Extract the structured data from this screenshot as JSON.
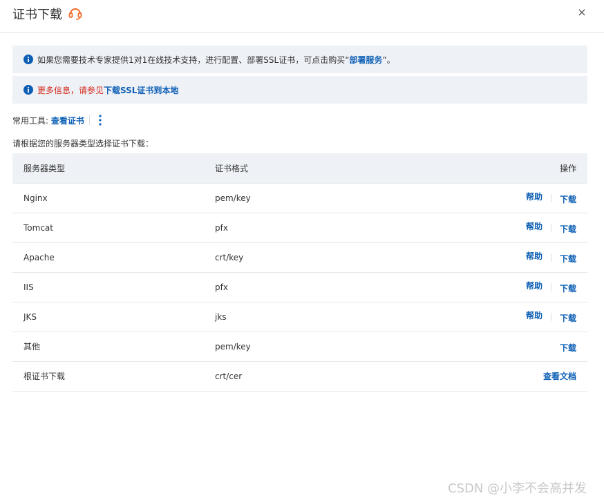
{
  "dialog": {
    "title": "证书下载",
    "close_symbol": "×"
  },
  "notice1": {
    "text_prefix": "如果您需要技术专家提供1对1在线技术支持，进行配置、部署SSL证书，可点击购买“",
    "link": "部署服务",
    "text_suffix": "”。"
  },
  "notice2": {
    "text_prefix": "更多信息，请参见",
    "link": "下载SSL证书到本地"
  },
  "tools": {
    "label": "常用工具:",
    "link": "查看证书"
  },
  "instruction": "请根据您的服务器类型选择证书下载：",
  "table": {
    "headers": [
      "服务器类型",
      "证书格式",
      "操作"
    ],
    "rows": [
      {
        "server": "Nginx",
        "format": "pem/key",
        "help": "帮助",
        "download": "下载"
      },
      {
        "server": "Tomcat",
        "format": "pfx",
        "help": "帮助",
        "download": "下载"
      },
      {
        "server": "Apache",
        "format": "crt/key",
        "help": "帮助",
        "download": "下载"
      },
      {
        "server": "IIS",
        "format": "pfx",
        "help": "帮助",
        "download": "下载"
      },
      {
        "server": "JKS",
        "format": "jks",
        "help": "帮助",
        "download": "下载"
      },
      {
        "server": "其他",
        "format": "pem/key",
        "download": "下载"
      },
      {
        "server": "根证书下载",
        "format": "crt/cer",
        "docs": "查看文档"
      }
    ]
  },
  "watermark": "CSDN @小李不会高并发",
  "colors": {
    "link": "#0d5fb5",
    "red": "#d4281a",
    "notice_bg": "#eef1f6",
    "support_icon": "#f26a2a"
  }
}
